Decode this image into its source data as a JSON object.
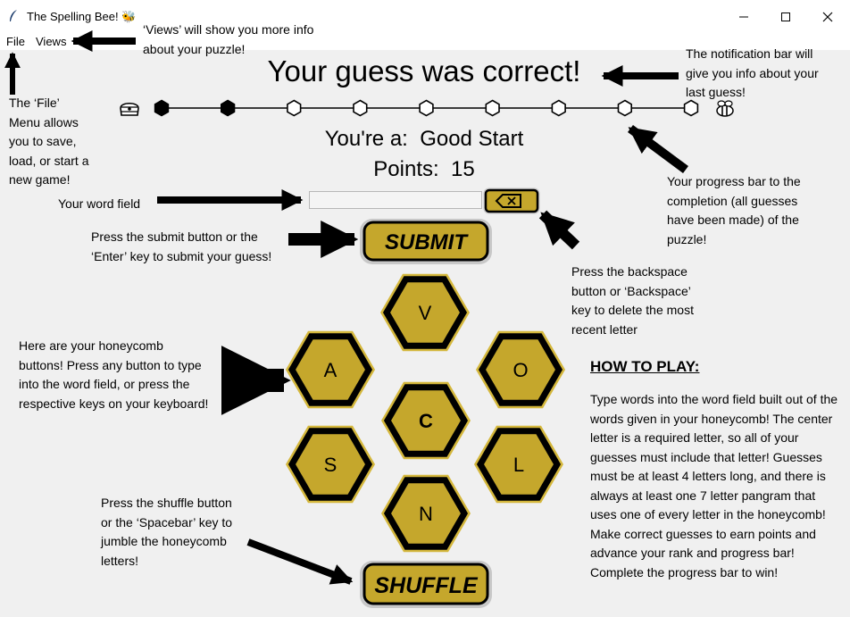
{
  "window": {
    "title": "The Spelling Bee! 🐝",
    "controls": [
      "minimize",
      "maximize",
      "close"
    ]
  },
  "menu": {
    "file": "File",
    "views": "Views"
  },
  "notification": "Your guess was correct!",
  "rank": {
    "label": "You're a:",
    "value": "Good Start"
  },
  "points": {
    "label": "Points:",
    "value": "15"
  },
  "word_field": {
    "value": ""
  },
  "progress": {
    "start_icon": "beehive-icon",
    "end_icon": "bee-icon",
    "total_steps": 9,
    "filled_steps": 2
  },
  "buttons": {
    "submit": "SUBMIT",
    "shuffle": "SHUFFLE",
    "backspace_icon": "backspace-icon"
  },
  "honeycomb": {
    "center": "C",
    "top": "V",
    "upper_left": "A",
    "upper_right": "O",
    "lower_left": "S",
    "lower_right": "L",
    "bottom": "N"
  },
  "annotations": {
    "views": "‘Views’ will show you more info\nabout your puzzle!",
    "file": "The ‘File’\nMenu allows\nyou to save,\nload, or start a\nnew game!",
    "notification": "The notification bar will\ngive you info about your\nlast guess!",
    "progress": "Your progress bar to the\ncompletion (all guesses\nhave been made) of the\npuzzle!",
    "word_field": "Your word field",
    "submit": "Press the submit button or the\n‘Enter’ key to submit your guess!",
    "backspace": "Press the backspace\nbutton or ‘Backspace’\nkey to delete the most\nrecent letter",
    "honeycomb": "Here are your honeycomb\nbuttons! Press any button to type\ninto the word field, or press the\nrespective keys on your keyboard!",
    "shuffle": "Press the shuffle button\nor the ‘Spacebar’ key to\njumble the honeycomb\nletters!"
  },
  "how_to_play": {
    "title": "HOW TO PLAY:",
    "body": "Type words into the word field built out of the words given in your honeycomb! The center letter is a required letter, so all of your guesses must include that letter!  Guesses must be at least 4 letters long, and there is always at least one 7 letter pangram that uses one of every letter in the honeycomb! Make correct guesses to earn points and advance your rank and progress bar! Complete the progress bar to win!"
  },
  "colors": {
    "honey_gold": "#c5a72c",
    "honey_gold_light": "#d4b73c",
    "hex_outline": "#000000",
    "button_rim": "#c8c8c8",
    "background": "#f0f0f0"
  }
}
